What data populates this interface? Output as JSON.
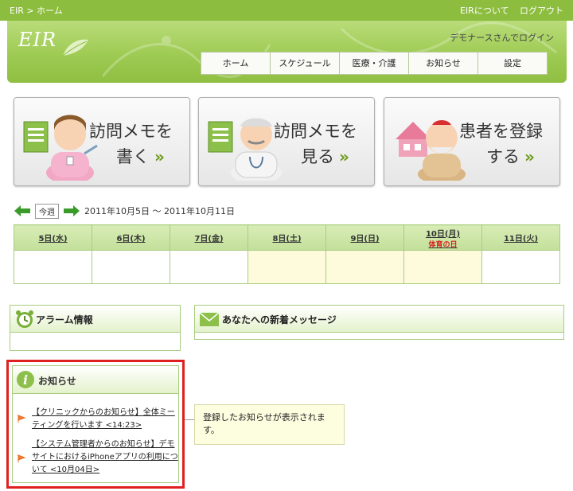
{
  "topbar": {
    "breadcrumb_root": "EIR",
    "breadcrumb_sep": ">",
    "breadcrumb_current": "ホーム",
    "about_label": "EIRについて",
    "logout_label": "ログアウト"
  },
  "header": {
    "logo_text": "EIR",
    "user_text": "デモナースさんでログイン",
    "nav": [
      "ホーム",
      "スケジュール",
      "医療・介護",
      "お知らせ",
      "設定"
    ]
  },
  "big_buttons": [
    {
      "line1": "訪問メモを",
      "line2": "書く",
      "arrow": "»"
    },
    {
      "line1": "訪問メモを",
      "line2": "見る",
      "arrow": "»"
    },
    {
      "line1": "患者を登録",
      "line2": "する",
      "arrow": "»"
    }
  ],
  "week": {
    "this_week_label": "今週",
    "range": "2011年10月5日 〜 2011年10月11日"
  },
  "calendar": {
    "days": [
      {
        "label": "5日(水)",
        "holiday": ""
      },
      {
        "label": "6日(木)",
        "holiday": ""
      },
      {
        "label": "7日(金)",
        "holiday": ""
      },
      {
        "label": "8日(土)",
        "holiday": ""
      },
      {
        "label": "9日(日)",
        "holiday": ""
      },
      {
        "label": "10日(月)",
        "holiday": "体育の日"
      },
      {
        "label": "11日(火)",
        "holiday": ""
      }
    ]
  },
  "alarm": {
    "title": "アラーム情報"
  },
  "messages": {
    "title": "あなたへの新着メッセージ"
  },
  "news": {
    "title": "お知らせ",
    "items": [
      "【クリニックからのお知らせ】全体ミーティングを行います <14:23>",
      "【システム管理者からのお知らせ】デモサイトにおけるiPhoneアプリの利用について <10月04日>"
    ]
  },
  "callout": {
    "text": "登録したお知らせが表示されます。"
  },
  "colors": {
    "accent": "#8dbd3f",
    "highlight_border": "#e02020",
    "holiday": "#d82020"
  }
}
